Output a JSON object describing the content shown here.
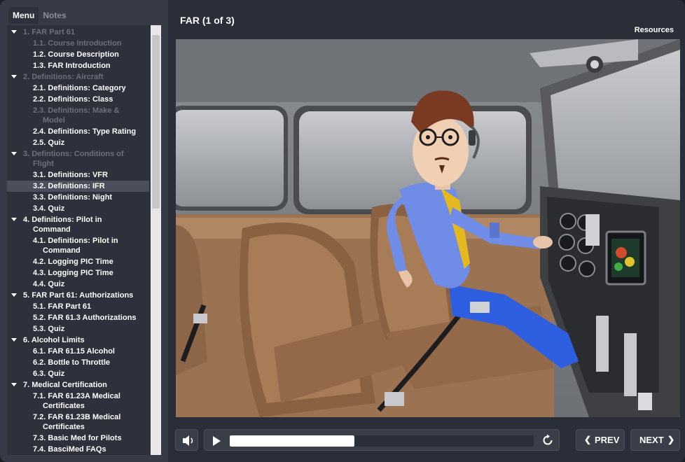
{
  "sidebar": {
    "tabs": {
      "menu": "Menu",
      "notes": "Notes"
    },
    "items": [
      {
        "num": "1.",
        "label": "FAR Part 61",
        "level": 0,
        "visited": true
      },
      {
        "num": "1.1.",
        "label": "Course Introduction",
        "level": 1,
        "visited": true
      },
      {
        "num": "1.2.",
        "label": "Course Description",
        "level": 1
      },
      {
        "num": "1.3.",
        "label": "FAR Introduction",
        "level": 1
      },
      {
        "num": "2.",
        "label": "Definitions: Aircraft",
        "level": 0,
        "visited": true
      },
      {
        "num": "2.1.",
        "label": "Definitions: Category",
        "level": 1
      },
      {
        "num": "2.2.",
        "label": "Definitions: Class",
        "level": 1
      },
      {
        "num": "2.3.",
        "label": "Definitions:  Make &",
        "wrap": "Model",
        "level": 1,
        "visited": true
      },
      {
        "num": "2.4.",
        "label": "Definitions: Type Rating",
        "level": 1
      },
      {
        "num": "2.5.",
        "label": "Quiz",
        "level": 1
      },
      {
        "num": "3.",
        "label": "Defintions: Conditions of",
        "wrap": "Flight",
        "level": 0,
        "visited": true
      },
      {
        "num": "3.1.",
        "label": "Definitions: VFR",
        "level": 1
      },
      {
        "num": "3.2.",
        "label": "Definitions: IFR",
        "level": 1,
        "selected": true
      },
      {
        "num": "3.3.",
        "label": "Definitions: Night",
        "level": 1
      },
      {
        "num": "3.4.",
        "label": "Quiz",
        "level": 1
      },
      {
        "num": "4.",
        "label": "Definitions: Pilot in",
        "wrap": "Command",
        "level": 0
      },
      {
        "num": "4.1.",
        "label": "Definitions: Pilot in",
        "wrap": "Command",
        "level": 1
      },
      {
        "num": "4.2.",
        "label": "Logging PIC Time",
        "level": 1
      },
      {
        "num": "4.3.",
        "label": "Logging PIC Time",
        "level": 1
      },
      {
        "num": "4.4.",
        "label": "Quiz",
        "level": 1
      },
      {
        "num": "5.",
        "label": "FAR Part 61: Authorizations",
        "level": 0
      },
      {
        "num": "5.1.",
        "label": "FAR Part 61",
        "level": 1
      },
      {
        "num": "5.2.",
        "label": "FAR 61.3 Authorizations",
        "level": 1
      },
      {
        "num": "5.3.",
        "label": "Quiz",
        "level": 1
      },
      {
        "num": "6.",
        "label": "Alcohol Limits",
        "level": 0
      },
      {
        "num": "6.1.",
        "label": "FAR 61.15 Alcohol",
        "level": 1
      },
      {
        "num": "6.2.",
        "label": "Bottle to Throttle",
        "level": 1
      },
      {
        "num": "6.3.",
        "label": "Quiz",
        "level": 1
      },
      {
        "num": "7.",
        "label": "Medical Certification",
        "level": 0
      },
      {
        "num": "7.1.",
        "label": "FAR 61.23A Medical",
        "wrap": "Certificates",
        "level": 1
      },
      {
        "num": "7.2.",
        "label": "FAR 61.23B Medical",
        "wrap": "Certificates",
        "level": 1
      },
      {
        "num": "7.3.",
        "label": "Basic Med for Pilots",
        "level": 1
      },
      {
        "num": "7.4.",
        "label": "BasciMed FAQs",
        "level": 1
      }
    ]
  },
  "header": {
    "slide_title": "FAR (1 of 3)",
    "resources_label": "Resources"
  },
  "player": {
    "progress_fraction": 0.41,
    "prev_label": "PREV",
    "next_label": "NEXT",
    "prev_icon": "chevron-left-icon",
    "next_icon": "chevron-right-icon",
    "volume_icon": "speaker-icon",
    "play_icon": "play-icon",
    "replay_icon": "replay-icon"
  },
  "colors": {
    "background": "#2a2e38",
    "sidebar": "#373b47",
    "menu_panel": "#2d313b",
    "visited_text": "#6a707e",
    "selected_row": "#4b4f5c"
  }
}
